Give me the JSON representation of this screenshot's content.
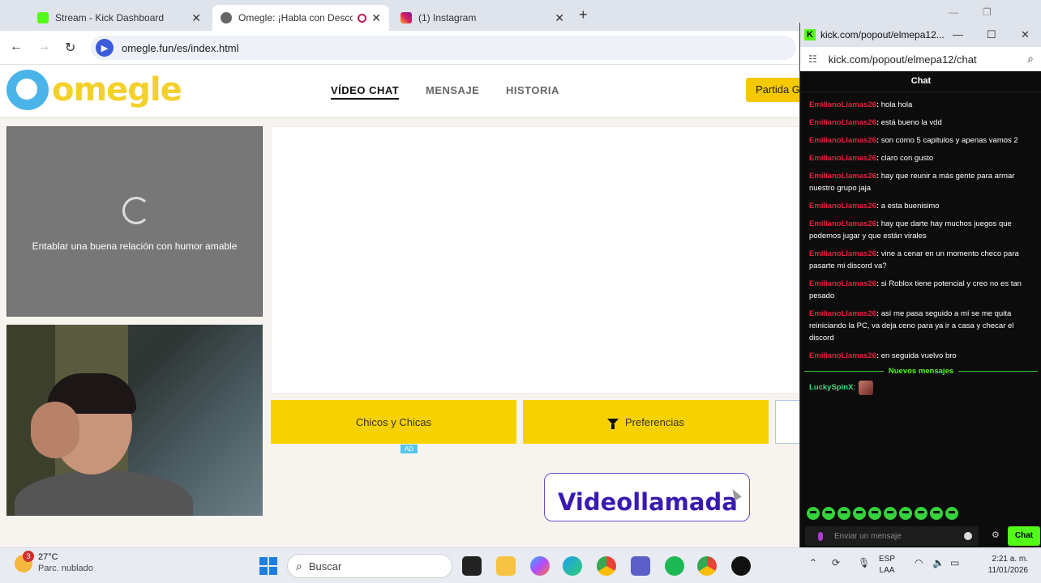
{
  "tabs": [
    {
      "label": "Stream - Kick Dashboard",
      "close": "✕"
    },
    {
      "label": "Omegle: ¡Habla con Descon",
      "close": "✕"
    },
    {
      "label": "(1) Instagram",
      "close": "✕"
    }
  ],
  "new_tab": "+",
  "address": {
    "url": "omegle.fun/es/index.html"
  },
  "site": {
    "logo_text": "omegle",
    "nav": [
      "VÍDEO CHAT",
      "MENSAJE",
      "HISTORIA"
    ],
    "start_button": "Partida G",
    "loading_text": "Entablar una buena relación con humor amable",
    "buttons": {
      "gender": "Chicos y Chicas",
      "preferences": "Preferencias"
    },
    "ad_tag": "AD",
    "promo_text": "Videollamada"
  },
  "popout": {
    "title": "kick.com/popout/elmepa12...",
    "url": "kick.com/popout/elmepa12/chat",
    "chat_header": "Chat",
    "messages": [
      {
        "user": "EmilianoLlamas26",
        "text": "hola hola"
      },
      {
        "user": "EmilianoLlamas26",
        "text": "está bueno la vdd"
      },
      {
        "user": "EmilianoLlamas26",
        "text": "son como 5 capitulos y apenas vamos 2"
      },
      {
        "user": "EmilianoLlamas26",
        "text": "claro con gusto"
      },
      {
        "user": "EmilianoLlamas26",
        "text": "hay que reunir a más gente para armar nuestro grupo jaja"
      },
      {
        "user": "EmilianoLlamas26",
        "text": "a esta buenisimo"
      },
      {
        "user": "EmilianoLlamas26",
        "text": "hay que darte hay muchos juegos que podemos jugar y que están virales"
      },
      {
        "user": "EmilianoLlamas26",
        "text": "vine a cenar en un momento checo para pasarte mi discord va?"
      },
      {
        "user": "EmilianoLlamas26",
        "text": "si Roblox tiene potencial y creo no es tan pesado"
      },
      {
        "user": "EmilianoLlamas26",
        "text": "así me pasa seguido a mí se me quita reiniciando la PC, va deja ceno para ya ir a casa y checar el discord"
      },
      {
        "user": "EmilianoLlamas26",
        "text": "en seguida vuelvo bro"
      }
    ],
    "new_messages_label": "Nuevos mensajes",
    "latest": {
      "user": "LuckySpinX"
    },
    "input_placeholder": "Enviar un mensaje",
    "send_label": "Chat"
  },
  "taskbar": {
    "weather_temp": "27°C",
    "weather_cond": "Parc. nublado",
    "weather_badge": "3",
    "search_label": "Buscar",
    "lang_line1": "ESP",
    "lang_line2": "LAA",
    "time": "2:21 a. m.",
    "date": "11/01/2026"
  },
  "colors": {
    "kick_green": "#53fc18",
    "omegle_yellow": "#f7d200",
    "chat_user_red": "#e8213e"
  }
}
